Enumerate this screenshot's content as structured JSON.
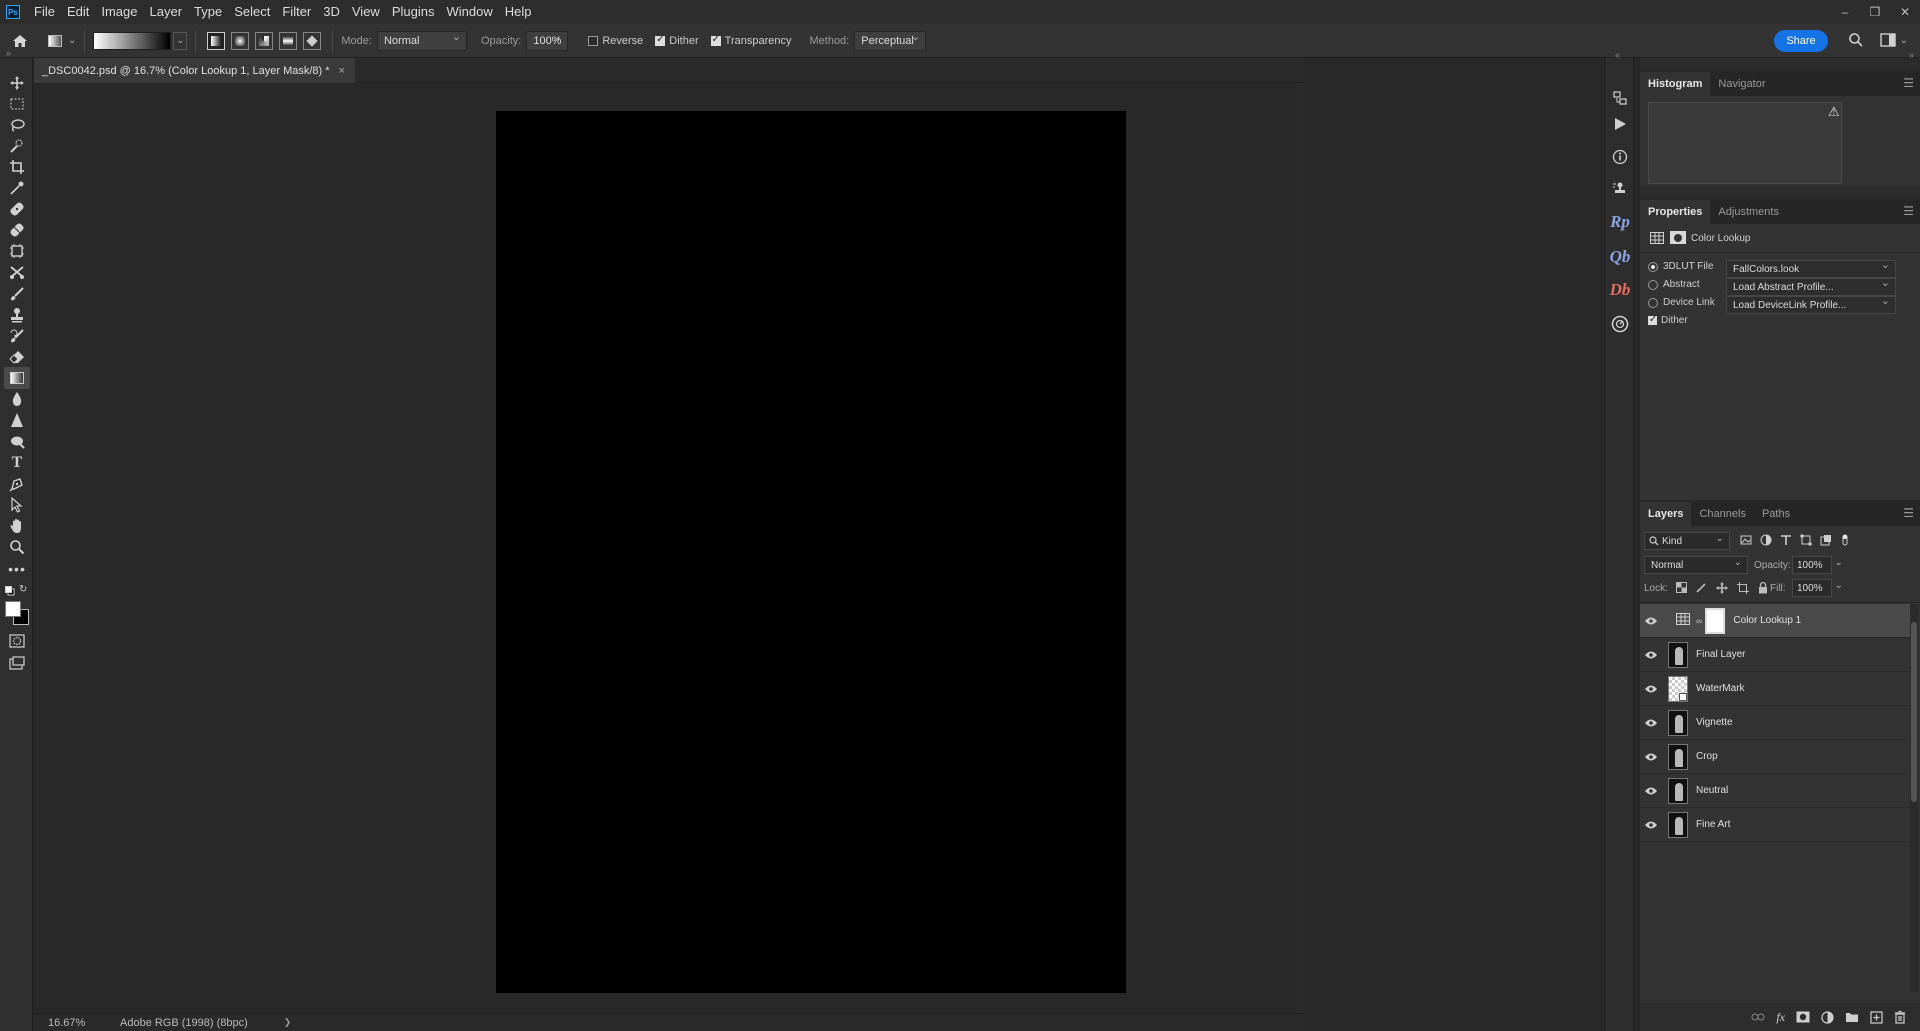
{
  "app": {
    "logo": "Ps"
  },
  "menu": [
    "File",
    "Edit",
    "Image",
    "Layer",
    "Type",
    "Select",
    "Filter",
    "3D",
    "View",
    "Plugins",
    "Window",
    "Help"
  ],
  "window_controls": {
    "minimize": "–",
    "restore": "❒",
    "close": "✕"
  },
  "options": {
    "mode_label": "Mode:",
    "mode_value": "Normal",
    "opacity_label": "Opacity:",
    "opacity_value": "100%",
    "reverse_label": "Reverse",
    "reverse_checked": false,
    "dither_label": "Dither",
    "dither_checked": true,
    "transparency_label": "Transparency",
    "transparency_checked": true,
    "method_label": "Method:",
    "method_value": "Perceptual",
    "share_label": "Share",
    "gradient_start_color": "#ffffff",
    "gradient_end_color": "#000000"
  },
  "toolbar": {
    "tools": [
      "move-tool-icon",
      "marquee-tool-icon",
      "lasso-tool-icon",
      "quick-select-tool-icon",
      "crop-tool-icon",
      "eyedropper-tool-icon",
      "healing-tool-icon",
      "patch-tool-icon",
      "frame-tool-icon",
      "content-aware-move-icon",
      "brush-tool-icon",
      "stamp-tool-icon",
      "history-brush-icon",
      "eraser-tool-icon",
      "gradient-tool-icon",
      "blur-tool-icon",
      "sharpen-tool-icon",
      "dodge-tool-icon",
      "type-tool-icon",
      "pen-tool-icon",
      "path-select-tool-icon",
      "hand-tool-icon",
      "zoom-tool-icon",
      "more-tools-icon"
    ],
    "active_tool": "gradient-tool-icon",
    "foreground_color": "#ffffff",
    "background_color": "#000000"
  },
  "document": {
    "tab_title": "_DSC0042.psd @ 16.7% (Color Lookup 1, Layer Mask/8) *",
    "tab_close": "×",
    "canvas_color": "#000000"
  },
  "status": {
    "zoom": "16.67%",
    "profile": "Adobe RGB (1998) (8bpc)",
    "arrow": "❯"
  },
  "dock": {
    "icons": [
      "history-icon",
      "actions-play-icon",
      "info-icon",
      "clone-source-icon"
    ],
    "plugins": [
      {
        "label": "Rp",
        "color": "#8aa4e0"
      },
      {
        "label": "Qb",
        "color": "#8aa4e0"
      },
      {
        "label": "Db",
        "color": "#e06d5f"
      }
    ]
  },
  "histogram_panel": {
    "tabs": [
      "Histogram",
      "Navigator"
    ],
    "active": 0,
    "warning": "⚠"
  },
  "properties_panel": {
    "tabs": [
      "Properties",
      "Adjustments"
    ],
    "active": 0,
    "adjustment_name": "Color Lookup",
    "options": [
      {
        "label": "3DLUT File",
        "checked": true,
        "value": "FallColors.look"
      },
      {
        "label": "Abstract",
        "checked": false,
        "value": "Load Abstract Profile..."
      },
      {
        "label": "Device Link",
        "checked": false,
        "value": "Load DeviceLink Profile..."
      }
    ],
    "dither_label": "Dither",
    "dither_checked": true
  },
  "layers_panel": {
    "tabs": [
      "Layers",
      "Channels",
      "Paths"
    ],
    "active": 0,
    "filter_value": "Kind",
    "blend_mode": "Normal",
    "opacity_label": "Opacity:",
    "opacity_value": "100%",
    "lock_label": "Lock:",
    "fill_label": "Fill:",
    "fill_value": "100%",
    "layers": [
      {
        "name": "Color Lookup 1",
        "type": "adjustment",
        "selected": true
      },
      {
        "name": "Final Layer",
        "type": "image",
        "selected": false
      },
      {
        "name": "WaterMark",
        "type": "smart",
        "selected": false
      },
      {
        "name": "Vignette",
        "type": "image",
        "selected": false
      },
      {
        "name": "Crop",
        "type": "image",
        "selected": false
      },
      {
        "name": "Neutral",
        "type": "image",
        "selected": false
      },
      {
        "name": "Fine Art",
        "type": "image",
        "selected": false
      }
    ]
  }
}
